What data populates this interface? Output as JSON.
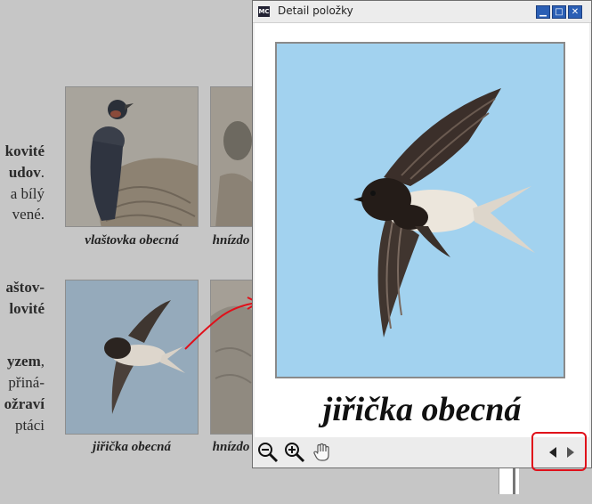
{
  "document": {
    "text_fragments": [
      {
        "text": "kovité",
        "bold": true
      },
      {
        "text": "udov",
        "bold": true,
        "suffix": "."
      },
      {
        "text": "a bílý",
        "bold": false
      },
      {
        "text": "vené.",
        "bold": false
      },
      {
        "text": "aštov-",
        "bold": true
      },
      {
        "text": "lovité",
        "bold": true
      },
      {
        "text": "yzem",
        "bold": true,
        "suffix": ","
      },
      {
        "text": "přiná-",
        "bold": false
      },
      {
        "text": "ožraví",
        "bold": true
      },
      {
        "text": "ptáci",
        "bold": false
      }
    ],
    "thumbnails": [
      {
        "caption": "vlaštovka obecná"
      },
      {
        "caption": "hnízdo"
      },
      {
        "caption": "jiřička obecná"
      },
      {
        "caption": "hnízdo"
      }
    ]
  },
  "dialog": {
    "title": "Detail položky",
    "app_icon": "MC",
    "controls": {
      "minimize": "▁",
      "maximize": "□",
      "close": "✕"
    },
    "photo_caption": "jiřička obecná",
    "photo_background": "#a2d2ef",
    "toolbar": {
      "zoom_out": "zoom-out-icon",
      "zoom_in": "zoom-in-icon",
      "pan": "hand-pan-icon",
      "prev": "◀",
      "next": "▶"
    }
  },
  "annotation": {
    "color": "#e0101a"
  }
}
